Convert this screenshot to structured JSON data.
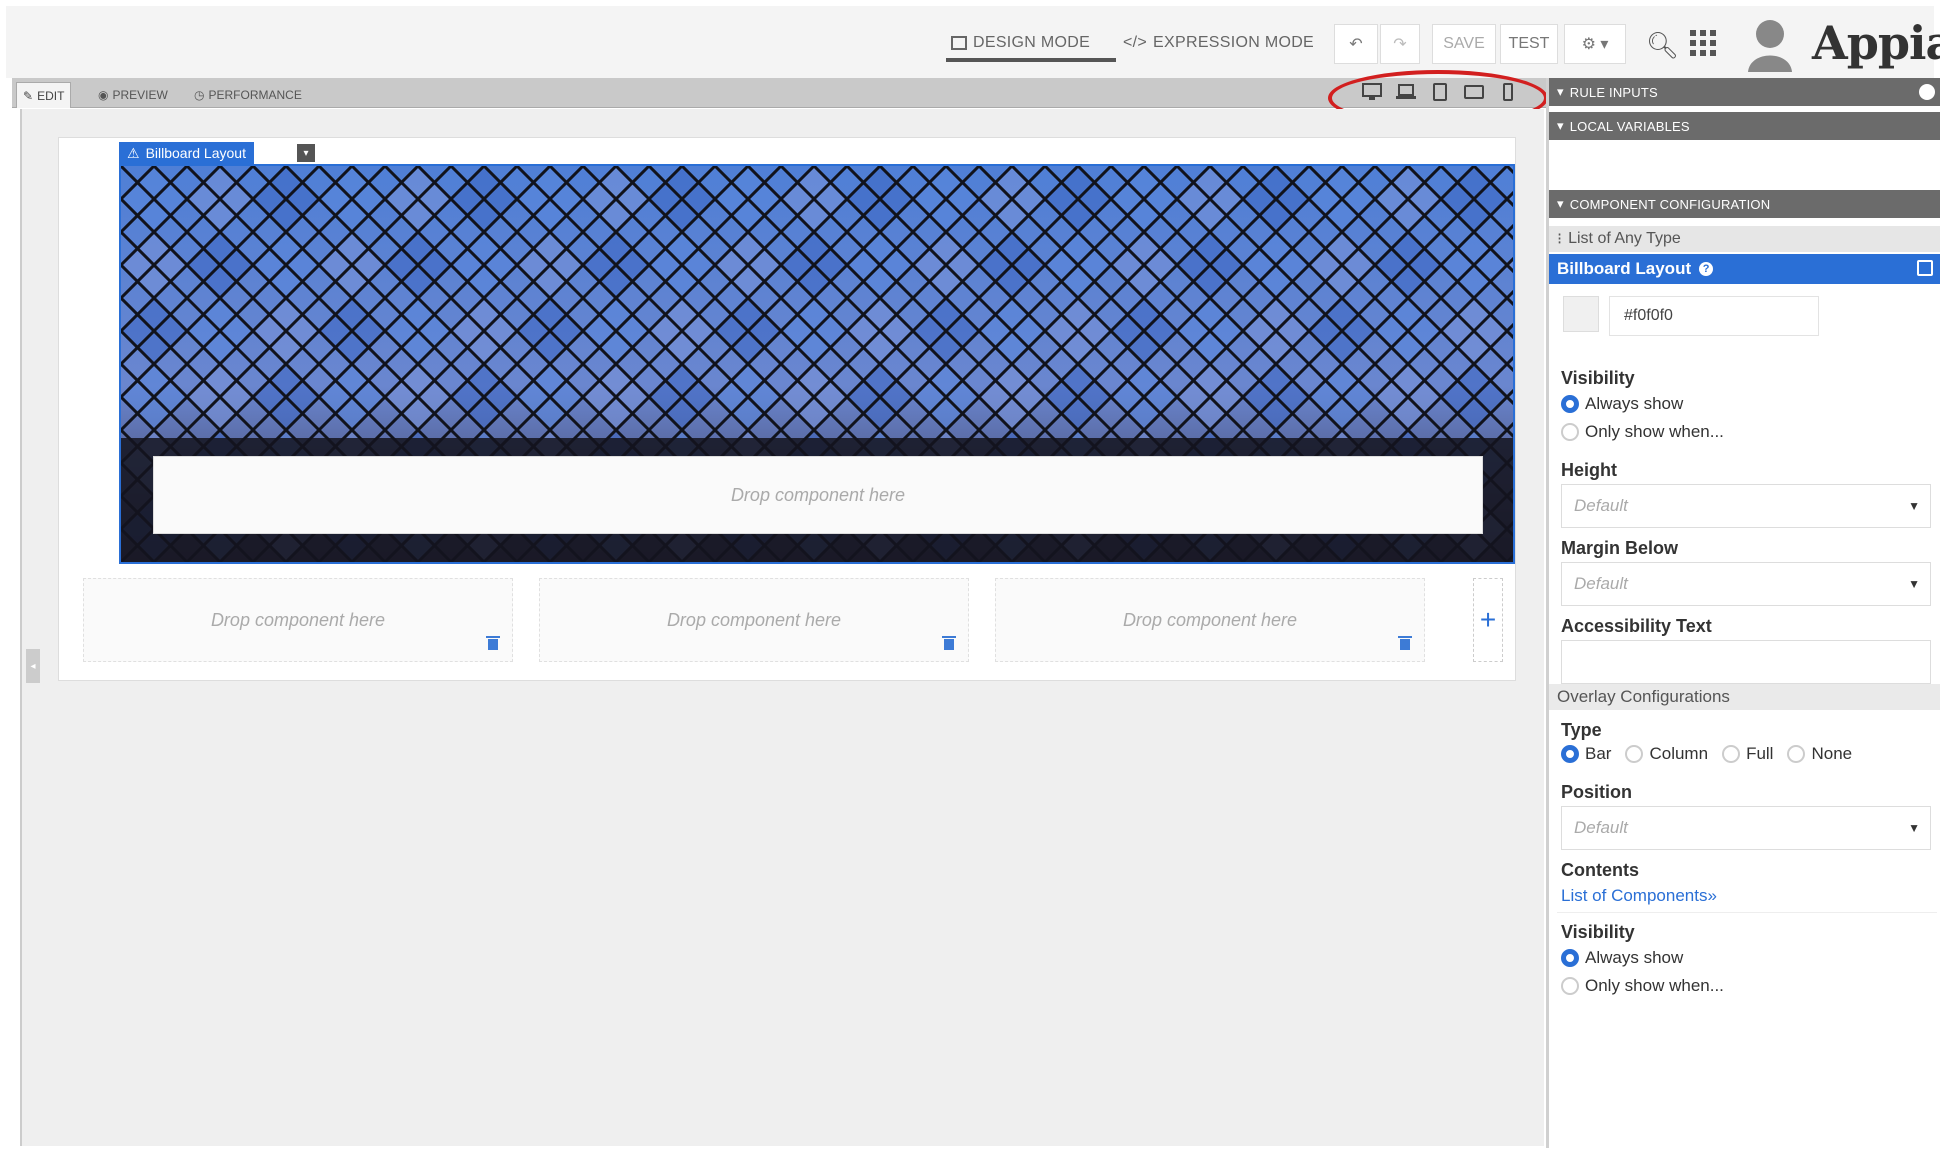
{
  "header": {
    "design_mode": "DESIGN MODE",
    "expression_mode": "EXPRESSION MODE",
    "save": "SAVE",
    "test": "TEST",
    "logo": "Appian"
  },
  "tabs": {
    "edit": "EDIT",
    "preview": "PREVIEW",
    "performance": "PERFORMANCE"
  },
  "canvas": {
    "billboard_label": "Billboard Layout",
    "drop_main": "Drop component here",
    "col1": "Drop component here",
    "col2": "Drop component here",
    "col3": "Drop component here",
    "add": "+"
  },
  "right_panel": {
    "rule_inputs": "RULE INPUTS",
    "local_variables": "LOCAL VARIABLES",
    "component_configuration": "COMPONENT CONFIGURATION",
    "type_header": "List of Any Type",
    "billboard_header": "Billboard Layout",
    "background_color": "#f0f0f0",
    "visibility_label": "Visibility",
    "always_show": "Always show",
    "only_show_when": "Only show when...",
    "height_label": "Height",
    "height_value": "Default",
    "margin_label": "Margin Below",
    "margin_value": "Default",
    "accessibility_label": "Accessibility Text",
    "overlay_header": "Overlay Configurations",
    "type_label": "Type",
    "type_options": [
      "Bar",
      "Column",
      "Full",
      "None"
    ],
    "position_label": "Position",
    "position_value": "Default",
    "contents_label": "Contents",
    "contents_link": "List of Components»",
    "visibility2_label": "Visibility",
    "always_show2": "Always show",
    "only_show_when2": "Only show when..."
  },
  "colors": {
    "accent": "#2a6fd6",
    "highlight_ellipse": "#d21f1f"
  }
}
